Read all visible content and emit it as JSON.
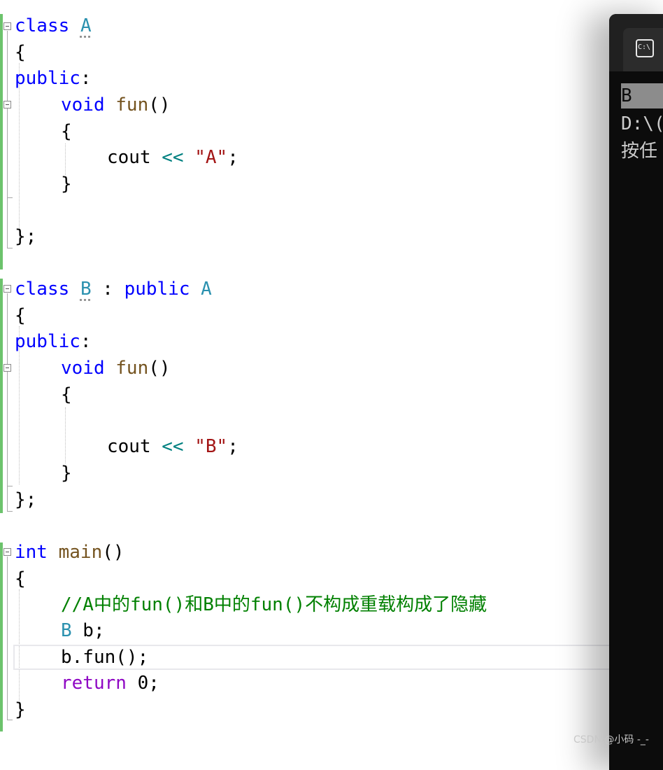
{
  "editor": {
    "lines": [
      [
        "class",
        " ",
        "A"
      ],
      [
        "{"
      ],
      [
        "public",
        ":"
      ],
      [
        "void",
        " ",
        "fun",
        "()"
      ],
      [
        "{"
      ],
      [
        "cout",
        " ",
        "<<",
        " ",
        "\"A\"",
        ";"
      ],
      [
        "}"
      ],
      [
        "};"
      ],
      [
        "class",
        " ",
        "B",
        " : ",
        "public",
        " ",
        "A"
      ],
      [
        "{"
      ],
      [
        "public",
        ":"
      ],
      [
        "void",
        " ",
        "fun",
        "()"
      ],
      [
        "{"
      ],
      [
        "cout",
        " ",
        "<<",
        " ",
        "\"B\"",
        ";"
      ],
      [
        "}"
      ],
      [
        "};"
      ],
      [
        "int",
        " ",
        "main",
        "()"
      ],
      [
        "{"
      ],
      [
        "//A中的fun()和B中的fun()不构成重载构成了隐藏"
      ],
      [
        "B",
        " b;"
      ],
      [
        "b.fun();"
      ],
      [
        "return",
        " 0;"
      ],
      [
        "}"
      ]
    ]
  },
  "console": {
    "icon": "terminal-icon",
    "icon_text": "C:\\",
    "output": [
      "B",
      "D:\\(",
      "按任"
    ]
  },
  "watermark": "CSDN @小码 -_-",
  "colors": {
    "keyword": "#0000ff",
    "class_name": "#2b91af",
    "function": "#74531f",
    "operator": "#008080",
    "string": "#a31515",
    "comment": "#008000",
    "control": "#8f08c4",
    "console_bg": "#0c0c0c",
    "console_text": "#cccccc"
  }
}
